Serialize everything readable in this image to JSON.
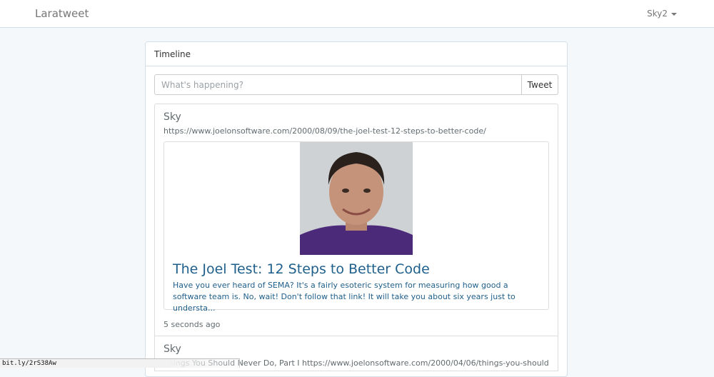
{
  "navbar": {
    "brand": "Laratweet",
    "user": "Sky2"
  },
  "timeline": {
    "heading": "Timeline",
    "compose": {
      "placeholder": "What's happening?",
      "tweet_button": "Tweet"
    },
    "tweets": [
      {
        "author": "Sky",
        "body": "https://www.joelonsoftware.com/2000/08/09/the-joel-test-12-steps-to-better-code/",
        "card": {
          "title": "The Joel Test: 12 Steps to Better Code",
          "description": "Have you ever heard of SEMA? It's a fairly esoteric system for measuring how good a software team is. No, wait! Don't follow that link! It will take you about six years just to understa..."
        },
        "time": "5 seconds ago"
      },
      {
        "author": "Sky",
        "body": "Things You Should Never Do, Part I https://www.joelonsoftware.com/2000/04/06/things-you-should-"
      }
    ]
  },
  "status_bar": {
    "url": "bit.ly/2rS38Aw"
  },
  "colors": {
    "link": "#1f5f8b",
    "page_bg": "#f5f8fa",
    "border": "#d3e0e9"
  }
}
